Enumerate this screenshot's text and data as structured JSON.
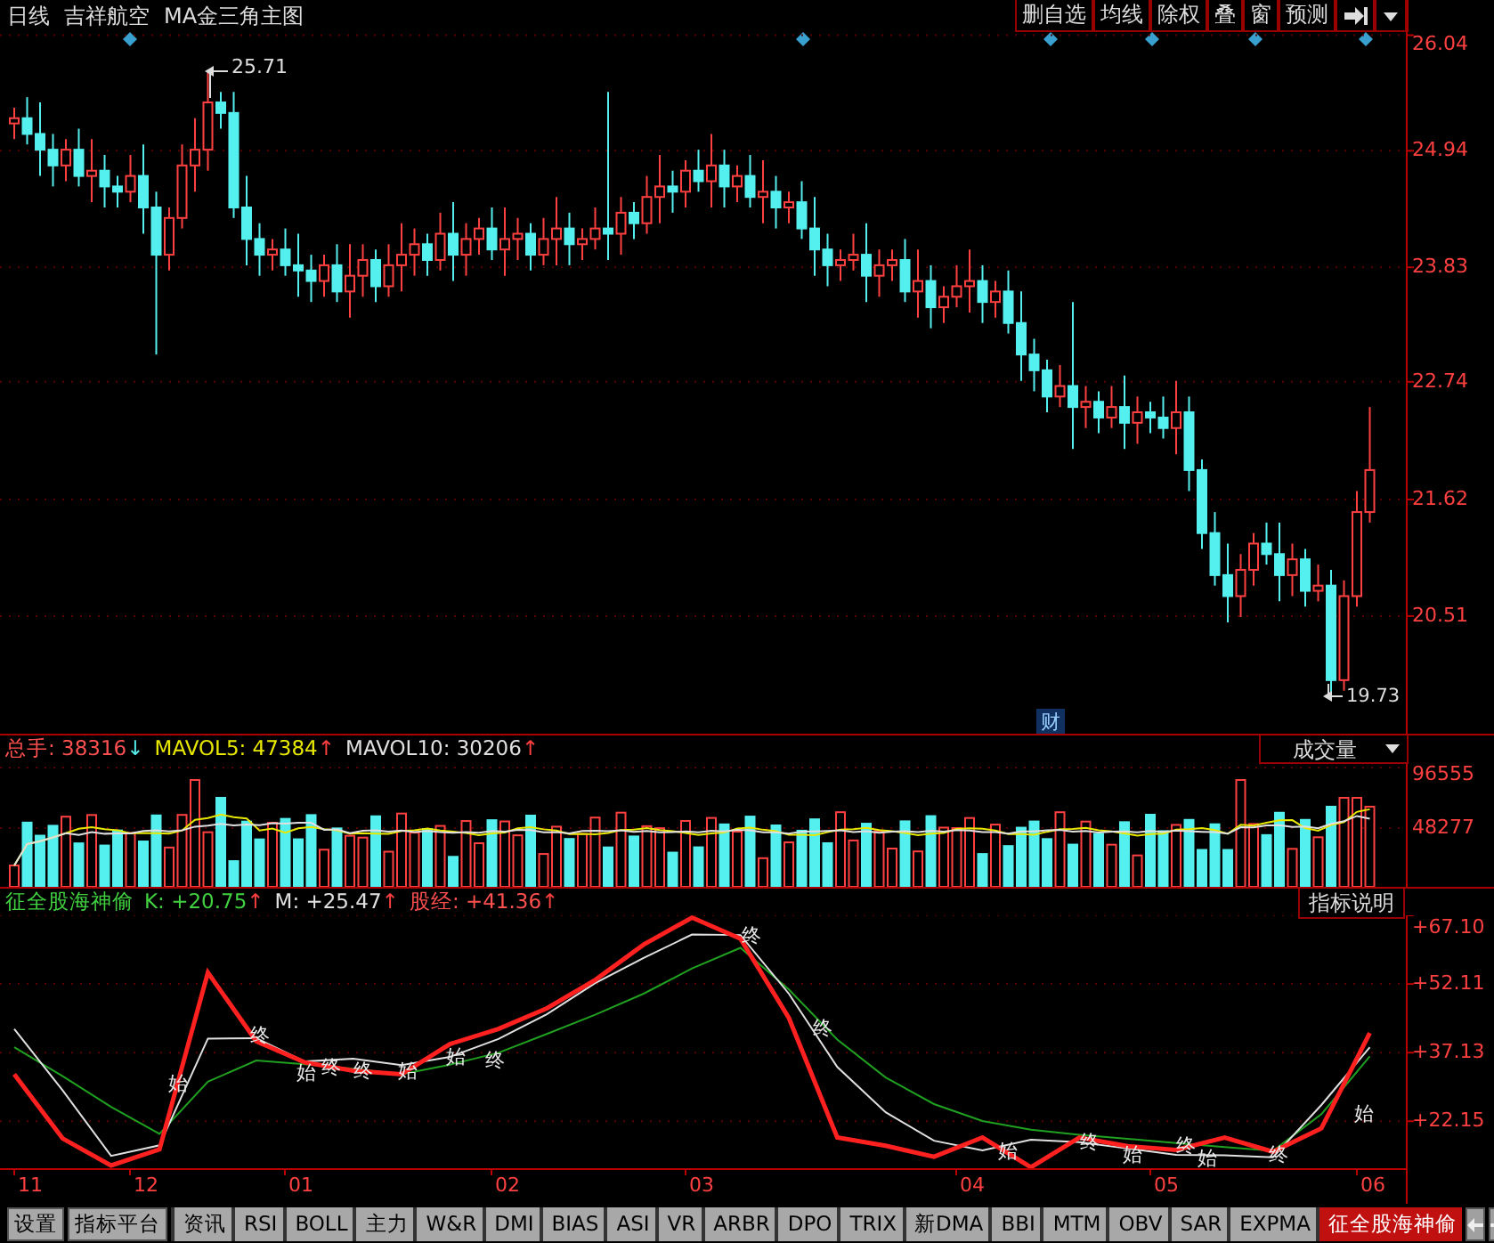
{
  "header": {
    "period": "日线",
    "stock": "吉祥航空",
    "template": "MA金三角主图"
  },
  "toolbar": [
    {
      "label": "删自选"
    },
    {
      "label": "均线"
    },
    {
      "label": "除权"
    },
    {
      "label": "叠"
    },
    {
      "label": "窗"
    },
    {
      "label": "预测"
    }
  ],
  "price_pane": {
    "chart_data": {
      "type": "candlestick",
      "ylim": [
        19.39,
        26.07
      ],
      "yticks": [
        26.04,
        24.94,
        23.83,
        22.74,
        21.62,
        20.51
      ],
      "grid": true,
      "ohlc": [
        [
          25.2,
          25.35,
          25.05,
          25.25
        ],
        [
          25.25,
          25.45,
          25.0,
          25.1
        ],
        [
          25.1,
          25.4,
          24.7,
          24.95
        ],
        [
          24.95,
          25.1,
          24.6,
          24.8
        ],
        [
          24.8,
          25.05,
          24.65,
          24.95
        ],
        [
          24.95,
          25.15,
          24.6,
          24.7
        ],
        [
          24.7,
          25.05,
          24.45,
          24.75
        ],
        [
          24.75,
          24.9,
          24.4,
          24.6
        ],
        [
          24.6,
          24.7,
          24.4,
          24.55
        ],
        [
          24.55,
          24.9,
          24.45,
          24.7
        ],
        [
          24.7,
          25.0,
          24.15,
          24.4
        ],
        [
          24.4,
          24.55,
          23.0,
          23.95
        ],
        [
          23.95,
          24.4,
          23.8,
          24.3
        ],
        [
          24.3,
          25.0,
          24.2,
          24.8
        ],
        [
          24.8,
          25.25,
          24.55,
          24.95
        ],
        [
          24.95,
          25.71,
          24.75,
          25.4
        ],
        [
          25.4,
          25.5,
          25.15,
          25.3
        ],
        [
          25.3,
          25.5,
          24.3,
          24.4
        ],
        [
          24.4,
          24.7,
          23.85,
          24.1
        ],
        [
          24.1,
          24.25,
          23.75,
          23.95
        ],
        [
          23.95,
          24.1,
          23.8,
          24.0
        ],
        [
          24.0,
          24.2,
          23.75,
          23.85
        ],
        [
          23.85,
          24.15,
          23.55,
          23.8
        ],
        [
          23.8,
          23.95,
          23.5,
          23.7
        ],
        [
          23.7,
          23.95,
          23.55,
          23.85
        ],
        [
          23.85,
          24.05,
          23.5,
          23.6
        ],
        [
          23.6,
          24.05,
          23.35,
          23.75
        ],
        [
          23.75,
          24.05,
          23.55,
          23.9
        ],
        [
          23.9,
          24.0,
          23.5,
          23.65
        ],
        [
          23.65,
          24.05,
          23.55,
          23.85
        ],
        [
          23.85,
          24.25,
          23.6,
          23.95
        ],
        [
          23.95,
          24.2,
          23.75,
          24.05
        ],
        [
          24.05,
          24.15,
          23.75,
          23.9
        ],
        [
          23.9,
          24.35,
          23.8,
          24.15
        ],
        [
          24.15,
          24.45,
          23.7,
          23.95
        ],
        [
          23.95,
          24.25,
          23.75,
          24.1
        ],
        [
          24.1,
          24.3,
          23.95,
          24.2
        ],
        [
          24.2,
          24.4,
          23.9,
          24.0
        ],
        [
          24.0,
          24.4,
          23.75,
          24.1
        ],
        [
          24.1,
          24.3,
          23.9,
          24.15
        ],
        [
          24.15,
          24.25,
          23.8,
          23.95
        ],
        [
          23.95,
          24.3,
          23.85,
          24.1
        ],
        [
          24.1,
          24.5,
          23.85,
          24.2
        ],
        [
          24.2,
          24.35,
          23.85,
          24.05
        ],
        [
          24.05,
          24.2,
          23.9,
          24.1
        ],
        [
          24.1,
          24.4,
          24.0,
          24.2
        ],
        [
          24.2,
          25.5,
          23.9,
          24.15
        ],
        [
          24.15,
          24.5,
          23.95,
          24.35
        ],
        [
          24.35,
          24.45,
          24.1,
          24.25
        ],
        [
          24.25,
          24.7,
          24.15,
          24.5
        ],
        [
          24.5,
          24.9,
          24.25,
          24.6
        ],
        [
          24.6,
          24.75,
          24.35,
          24.55
        ],
        [
          24.55,
          24.85,
          24.4,
          24.75
        ],
        [
          24.75,
          24.95,
          24.55,
          24.65
        ],
        [
          24.65,
          25.1,
          24.4,
          24.8
        ],
        [
          24.8,
          24.95,
          24.4,
          24.6
        ],
        [
          24.6,
          24.8,
          24.45,
          24.7
        ],
        [
          24.7,
          24.9,
          24.4,
          24.5
        ],
        [
          24.5,
          24.85,
          24.25,
          24.55
        ],
        [
          24.55,
          24.7,
          24.2,
          24.4
        ],
        [
          24.4,
          24.55,
          24.25,
          24.45
        ],
        [
          24.45,
          24.65,
          24.1,
          24.2
        ],
        [
          24.2,
          24.5,
          23.75,
          24.0
        ],
        [
          24.0,
          24.15,
          23.65,
          23.85
        ],
        [
          23.85,
          24.0,
          23.7,
          23.9
        ],
        [
          23.9,
          24.15,
          23.8,
          23.95
        ],
        [
          23.95,
          24.25,
          23.5,
          23.75
        ],
        [
          23.75,
          24.0,
          23.55,
          23.85
        ],
        [
          23.85,
          24.0,
          23.7,
          23.9
        ],
        [
          23.9,
          24.1,
          23.5,
          23.6
        ],
        [
          23.6,
          24.0,
          23.35,
          23.7
        ],
        [
          23.7,
          23.85,
          23.25,
          23.45
        ],
        [
          23.45,
          23.65,
          23.3,
          23.55
        ],
        [
          23.55,
          23.85,
          23.45,
          23.65
        ],
        [
          23.65,
          24.0,
          23.4,
          23.7
        ],
        [
          23.7,
          23.85,
          23.3,
          23.5
        ],
        [
          23.5,
          23.7,
          23.35,
          23.6
        ],
        [
          23.6,
          23.8,
          23.2,
          23.3
        ],
        [
          23.3,
          23.6,
          22.75,
          23.0
        ],
        [
          23.0,
          23.15,
          22.65,
          22.85
        ],
        [
          22.85,
          22.95,
          22.45,
          22.6
        ],
        [
          22.6,
          22.9,
          22.5,
          22.7
        ],
        [
          22.7,
          23.5,
          22.1,
          22.5
        ],
        [
          22.5,
          22.7,
          22.3,
          22.55
        ],
        [
          22.55,
          22.65,
          22.25,
          22.4
        ],
        [
          22.4,
          22.7,
          22.3,
          22.5
        ],
        [
          22.5,
          22.8,
          22.1,
          22.35
        ],
        [
          22.35,
          22.6,
          22.15,
          22.45
        ],
        [
          22.45,
          22.55,
          22.25,
          22.4
        ],
        [
          22.4,
          22.6,
          22.2,
          22.3
        ],
        [
          22.3,
          22.75,
          22.05,
          22.45
        ],
        [
          22.45,
          22.6,
          21.7,
          21.9
        ],
        [
          21.9,
          22.0,
          21.15,
          21.3
        ],
        [
          21.3,
          21.5,
          20.8,
          20.9
        ],
        [
          20.9,
          21.2,
          20.45,
          20.7
        ],
        [
          20.7,
          21.1,
          20.5,
          20.95
        ],
        [
          20.95,
          21.3,
          20.8,
          21.2
        ],
        [
          21.2,
          21.4,
          21.0,
          21.1
        ],
        [
          21.1,
          21.4,
          20.65,
          20.9
        ],
        [
          20.9,
          21.2,
          20.7,
          21.05
        ],
        [
          21.05,
          21.15,
          20.6,
          20.75
        ],
        [
          20.75,
          21.0,
          20.65,
          20.8
        ],
        [
          20.8,
          20.95,
          19.73,
          19.9
        ],
        [
          19.9,
          20.85,
          19.8,
          20.7
        ],
        [
          20.7,
          21.7,
          20.6,
          21.5
        ],
        [
          21.5,
          22.5,
          21.4,
          21.9
        ]
      ]
    },
    "high_label": "25.71",
    "low_label": "19.73",
    "event_mark": "财"
  },
  "volume_pane": {
    "readings": [
      {
        "label": "总手:",
        "value": "38316",
        "color": "#ff5050",
        "arrow": {
          "text": "↓",
          "color": "#54f0f0"
        }
      },
      {
        "label": "MAVOL5:",
        "value": "47384",
        "color": "#e8e800",
        "arrow": {
          "text": "↑",
          "color": "#ff4040"
        }
      },
      {
        "label": "MAVOL10:",
        "value": "30206",
        "color": "#e0e0e0",
        "arrow": {
          "text": "↑",
          "color": "#ff4040"
        }
      }
    ],
    "selector": "成交量",
    "axis": [
      "96555",
      "48277"
    ]
  },
  "indicator_pane": {
    "name": "征全股海神偷",
    "readings": [
      {
        "label": "K:",
        "value": "+20.75",
        "color": "#40d040",
        "arrow": {
          "text": "↑",
          "color": "#ff4040"
        }
      },
      {
        "label": "M:",
        "value": "+25.47",
        "color": "#e0e0e0",
        "arrow": {
          "text": "↑",
          "color": "#ff4040"
        }
      },
      {
        "label": "股经:",
        "value": "+41.36",
        "color": "#ff5050",
        "arrow": {
          "text": "↑",
          "color": "#ff4040"
        }
      }
    ],
    "help_button": "指标说明",
    "chart_data": {
      "type": "line",
      "ylim": [
        11.9,
        67.1
      ],
      "yticks": [
        {
          "value": 67.1,
          "label": "+67.10"
        },
        {
          "value": 52.11,
          "label": "+52.11"
        },
        {
          "value": 37.13,
          "label": "+37.13"
        },
        {
          "value": 22.15,
          "label": "+22.15"
        }
      ],
      "grid": true,
      "series": [
        {
          "color": "#20a020",
          "values": [
            38.3,
            32.0,
            25.3,
            19.4,
            30.8,
            35.4,
            34.6,
            33.6,
            32.4,
            34.5,
            37.1,
            41.2,
            45.4,
            50.0,
            55.5,
            60.0,
            50.9,
            40.0,
            31.7,
            25.9,
            22.2,
            20.3,
            19.2,
            18.3,
            17.4,
            16.5,
            15.7,
            23.7,
            36.3
          ]
        },
        {
          "color": "#e0e0e0",
          "values": [
            42.3,
            28.9,
            14.6,
            16.9,
            40.2,
            40.3,
            35.2,
            35.8,
            34.4,
            36.2,
            40.1,
            45.5,
            52.3,
            57.8,
            62.9,
            62.8,
            50.0,
            34.0,
            24.1,
            17.9,
            15.8,
            18.1,
            17.6,
            16.2,
            14.8,
            14.7,
            14.3,
            25.7,
            38.3
          ]
        },
        {
          "color": "#ff2020",
          "values": [
            32.4,
            18.4,
            12.5,
            16.0,
            54.6,
            39.6,
            35.0,
            33.2,
            32.4,
            39.0,
            42.3,
            46.8,
            53.0,
            60.7,
            66.6,
            62.0,
            44.7,
            18.6,
            16.8,
            14.4,
            18.6,
            12.1,
            18.6,
            16.7,
            15.9,
            18.6,
            15.5,
            20.6,
            41.4
          ]
        }
      ]
    },
    "markers": [
      {
        "text": "始"
      },
      {
        "text": "终"
      },
      {
        "text": "始"
      },
      {
        "text": "终"
      },
      {
        "text": "终"
      },
      {
        "text": "始"
      },
      {
        "text": "始"
      },
      {
        "text": "终"
      },
      {
        "text": "终"
      },
      {
        "text": "终"
      },
      {
        "text": "始"
      },
      {
        "text": "终"
      },
      {
        "text": "始"
      },
      {
        "text": "终"
      },
      {
        "text": "始"
      },
      {
        "text": "终"
      },
      {
        "text": "始"
      }
    ]
  },
  "date_axis": [
    "11",
    "12",
    "01",
    "02",
    "03",
    "04",
    "05",
    "06"
  ],
  "tabs": [
    {
      "label": "设置",
      "kind": "button"
    },
    {
      "label": "指标平台",
      "kind": "button"
    },
    {
      "label": "资讯",
      "kind": "tab",
      "selected": false
    },
    {
      "label": "RSI",
      "kind": "tab",
      "selected": false
    },
    {
      "label": "BOLL",
      "kind": "tab",
      "selected": false
    },
    {
      "label": "主力",
      "kind": "tab",
      "selected": false
    },
    {
      "label": "W&R",
      "kind": "tab",
      "selected": false
    },
    {
      "label": "DMI",
      "kind": "tab",
      "selected": false
    },
    {
      "label": "BIAS",
      "kind": "tab",
      "selected": false
    },
    {
      "label": "ASI",
      "kind": "tab",
      "selected": false
    },
    {
      "label": "VR",
      "kind": "tab",
      "selected": false
    },
    {
      "label": "ARBR",
      "kind": "tab",
      "selected": false
    },
    {
      "label": "DPO",
      "kind": "tab",
      "selected": false
    },
    {
      "label": "TRIX",
      "kind": "tab",
      "selected": false
    },
    {
      "label": "新DMA",
      "kind": "tab",
      "selected": false
    },
    {
      "label": "BBI",
      "kind": "tab",
      "selected": false
    },
    {
      "label": "MTM",
      "kind": "tab",
      "selected": false
    },
    {
      "label": "OBV",
      "kind": "tab",
      "selected": false
    },
    {
      "label": "SAR",
      "kind": "tab",
      "selected": false
    },
    {
      "label": "EXPMA",
      "kind": "tab",
      "selected": false
    },
    {
      "label": "征全股海神偷",
      "kind": "tab",
      "selected": true
    }
  ]
}
